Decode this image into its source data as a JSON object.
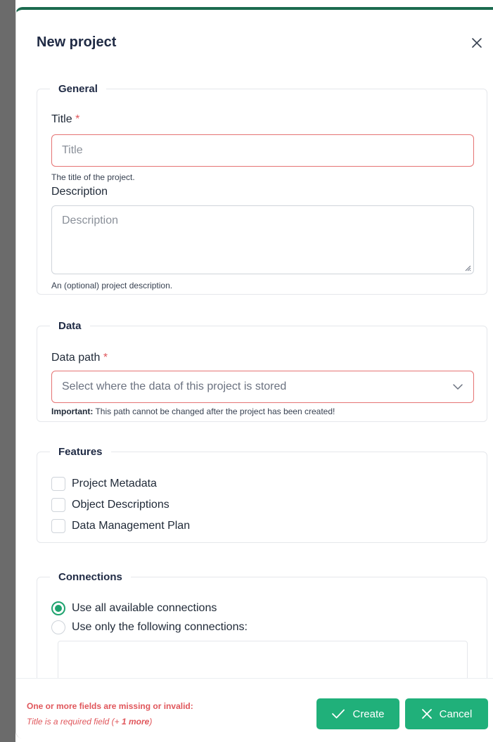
{
  "modal": {
    "title": "New project"
  },
  "general": {
    "legend": "General",
    "title_label": "Title",
    "title_required": "*",
    "title_placeholder": "Title",
    "title_help": "The title of the project.",
    "description_label": "Description",
    "description_placeholder": "Description",
    "description_help": "An (optional) project description."
  },
  "data": {
    "legend": "Data",
    "path_label": "Data path",
    "path_required": "*",
    "path_placeholder": "Select where the data of this project is stored",
    "path_help_strong": "Important:",
    "path_help": " This path cannot be changed after the project has been created!"
  },
  "features": {
    "legend": "Features",
    "items": [
      {
        "label": "Project Metadata",
        "checked": false
      },
      {
        "label": "Object Descriptions",
        "checked": false
      },
      {
        "label": "Data Management Plan",
        "checked": false
      }
    ]
  },
  "connections": {
    "legend": "Connections",
    "options": [
      {
        "label": "Use all available connections",
        "selected": true
      },
      {
        "label": "Use only the following connections:",
        "selected": false
      }
    ]
  },
  "footer": {
    "error_title": "One or more fields are missing or invalid:",
    "error_detail_prefix": "Title is a required field (+ ",
    "error_detail_more": "1 more",
    "error_detail_suffix": ")",
    "create_label": "Create",
    "cancel_label": "Cancel"
  },
  "colors": {
    "accent": "#20b07a",
    "error": "#e0565b",
    "header_border": "#1b6b4f"
  }
}
